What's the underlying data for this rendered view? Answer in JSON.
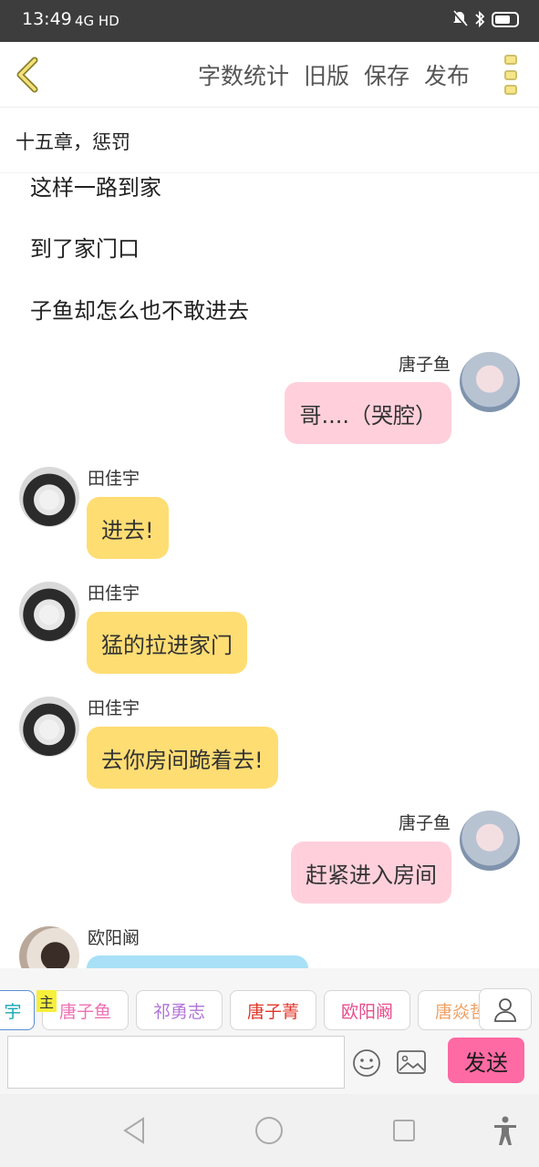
{
  "status_bar": {
    "time": "13:49",
    "network": "4G HD"
  },
  "toolbar": {
    "word_count": "字数统计",
    "old_version": "旧版",
    "save": "保存",
    "publish": "发布"
  },
  "chapter_title": "十五章，惩罚",
  "narration": [
    "这样一路到家",
    "到了家门口",
    "子鱼却怎么也不敢进去"
  ],
  "messages": [
    {
      "side": "right",
      "name": "唐子鱼",
      "text": "哥....（哭腔）",
      "color": "#ffd0dc"
    },
    {
      "side": "left",
      "name": "田佳宇",
      "text": "进去!",
      "color": "#fedd73"
    },
    {
      "side": "left",
      "name": "田佳宇",
      "text": "猛的拉进家门",
      "color": "#fedd73"
    },
    {
      "side": "left",
      "name": "田佳宇",
      "text": "去你房间跪着去!",
      "color": "#fedd73"
    },
    {
      "side": "right",
      "name": "唐子鱼",
      "text": "赶紧进入房间",
      "color": "#ffd0dc"
    },
    {
      "side": "left",
      "name": "欧阳阚",
      "text": "",
      "color": "#a8e0f7"
    }
  ],
  "characters": {
    "host_badge": "主",
    "chips": [
      {
        "label": "宇",
        "color": "#16a8b5"
      },
      {
        "label": "唐子鱼",
        "color": "#f06fb4"
      },
      {
        "label": "祁勇志",
        "color": "#b074d6"
      },
      {
        "label": "唐子菁",
        "color": "#e0362a"
      },
      {
        "label": "欧阳阚",
        "color": "#e84a8c"
      },
      {
        "label": "唐焱哲",
        "color": "#f0a064"
      }
    ]
  },
  "composer": {
    "value": "",
    "placeholder": "",
    "send_label": "发送"
  },
  "icons": [
    "back-icon",
    "more-icon",
    "emoji-icon",
    "image-icon",
    "person-icon",
    "nav-back-icon",
    "nav-home-icon",
    "nav-recents-icon",
    "accessibility-icon"
  ]
}
